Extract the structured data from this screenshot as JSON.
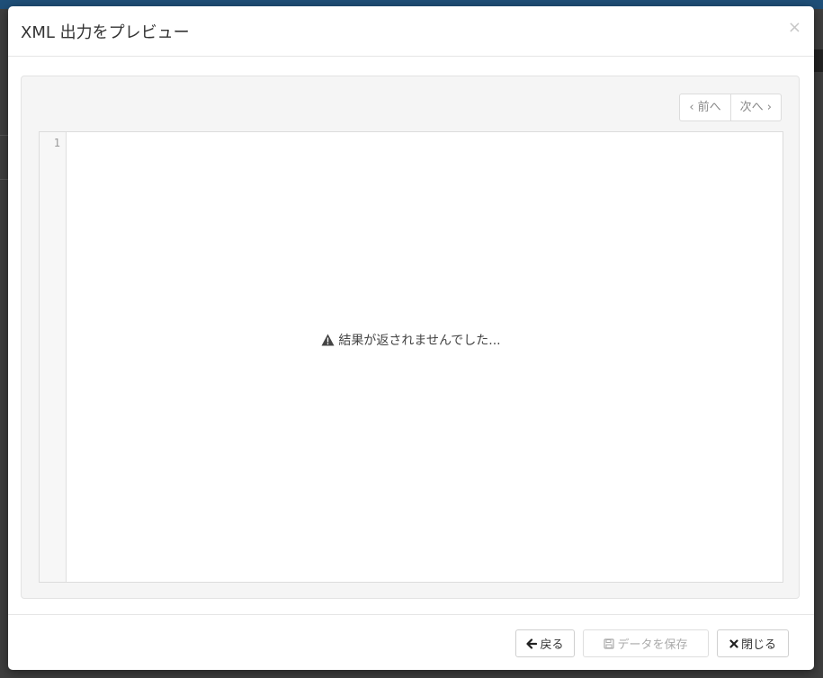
{
  "dialog": {
    "title": "XML 出力をプレビュー",
    "close_glyph": "×"
  },
  "pager": {
    "prev_label": "‹ 前へ",
    "next_label": "次へ ›"
  },
  "editor": {
    "line_number": "1",
    "empty_message": "結果が返されませんでした..."
  },
  "footer": {
    "back_label": "戻る",
    "save_label": "データを保存",
    "close_label": "閉じる"
  },
  "icons": {
    "warning": "warning-icon",
    "back": "arrow-left-icon",
    "save": "floppy-disk-icon",
    "close": "close-icon"
  },
  "colors": {
    "header_bar": "#1f4f78",
    "well_background": "#f5f5f5",
    "text": "#333333",
    "disabled_text": "#aaaaaa"
  }
}
